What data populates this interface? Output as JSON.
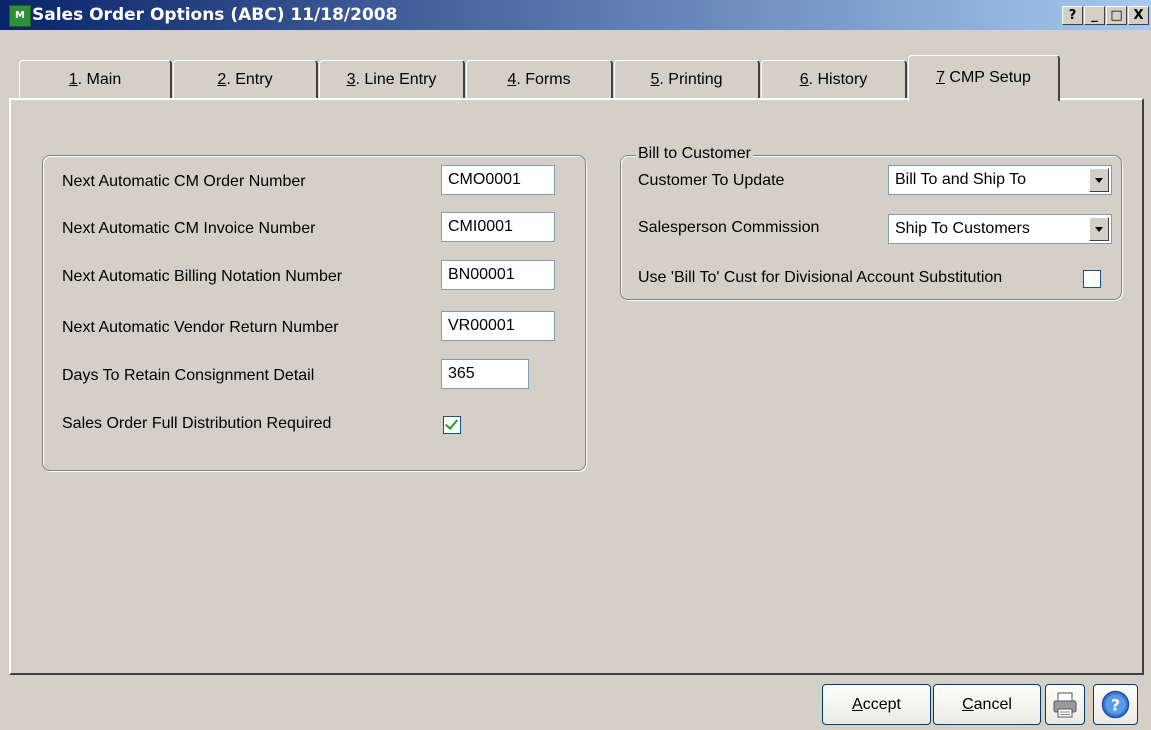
{
  "window": {
    "title": "Sales Order Options (ABC) 11/18/2008",
    "app_icon": "M",
    "controls": {
      "help": "?",
      "minimize": "_",
      "maximize": "□",
      "close": "X"
    }
  },
  "tabs": [
    {
      "num": "1",
      "label": ". Main"
    },
    {
      "num": "2",
      "label": ". Entry"
    },
    {
      "num": "3",
      "label": ". Line Entry"
    },
    {
      "num": "4",
      "label": ". Forms"
    },
    {
      "num": "5",
      "label": ". Printing"
    },
    {
      "num": "6",
      "label": ". History"
    },
    {
      "num": "7",
      "label": " CMP Setup"
    }
  ],
  "left_group": {
    "rows": [
      {
        "label": "Next Automatic CM Order Number",
        "value": "CMO0001"
      },
      {
        "label": "Next Automatic CM Invoice Number",
        "value": "CMI0001"
      },
      {
        "label": "Next Automatic  Billing Notation Number",
        "value": "BN00001"
      },
      {
        "label": "Next Automatic Vendor Return Number",
        "value": "VR00001"
      },
      {
        "label": "Days To Retain Consignment Detail",
        "value": "365"
      }
    ],
    "full_distribution": {
      "label": "Sales Order Full Distribution Required",
      "checked": true
    }
  },
  "right_group": {
    "title": "Bill to Customer",
    "customer_update": {
      "label": "Customer To Update",
      "value": "Bill To and Ship To"
    },
    "salesperson_commission": {
      "label": "Salesperson Commission",
      "value": "Ship To Customers"
    },
    "use_bill_to": {
      "label": "Use 'Bill To' Cust for Divisional Account Substitution",
      "checked": false
    }
  },
  "buttons": {
    "accept_u": "A",
    "accept_rest": "ccept",
    "cancel_u": "C",
    "cancel_rest": "ancel"
  },
  "icons": {
    "print": "printer-icon",
    "help": "help-icon"
  }
}
